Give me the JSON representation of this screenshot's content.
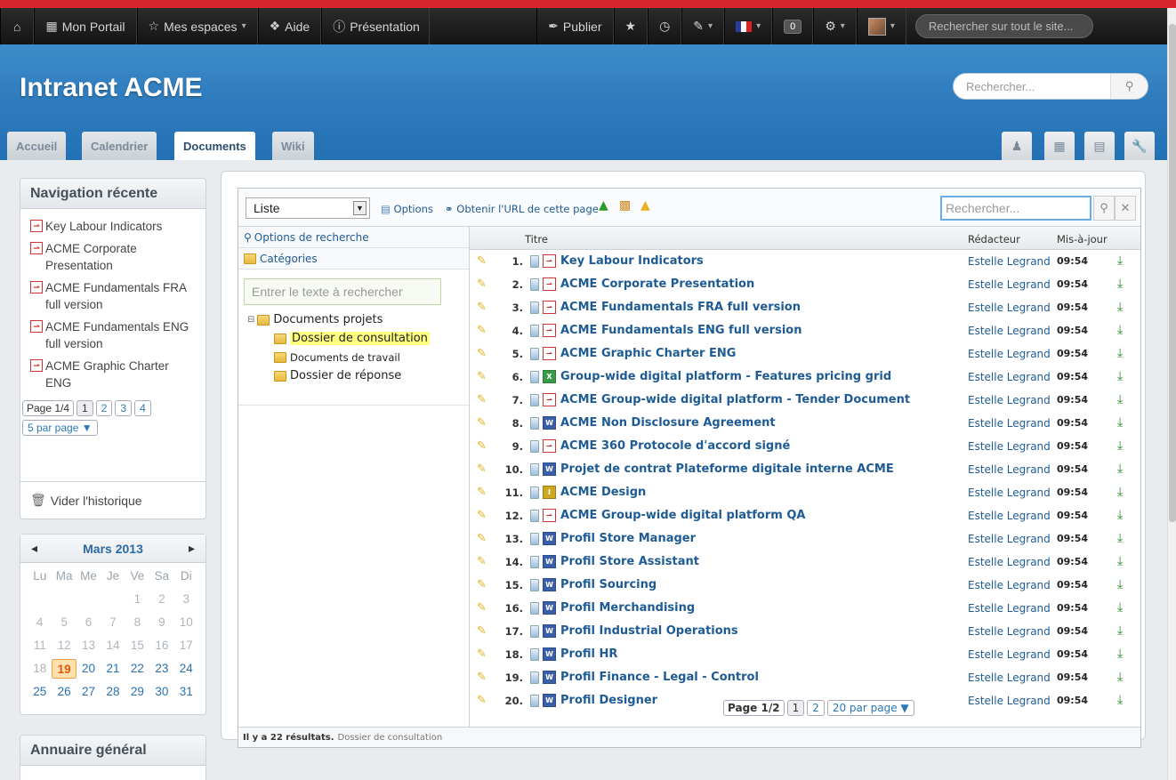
{
  "topbar": {
    "home_icon": "home-icon",
    "portal": "Mon Portail",
    "spaces": "Mes espaces",
    "help": "Aide",
    "presentation": "Présentation",
    "publish": "Publier",
    "notif_count": "0",
    "search_placeholder": "Rechercher sur tout le site..."
  },
  "banner": {
    "title": "Intranet ACME",
    "search_placeholder": "Rechercher..."
  },
  "tabs": [
    {
      "label": "Accueil"
    },
    {
      "label": "Calendrier"
    },
    {
      "label": "Documents"
    },
    {
      "label": "Wiki"
    }
  ],
  "recent_nav": {
    "title": "Navigation récente",
    "items": [
      "Key Labour Indicators",
      "ACME Corporate Presentation",
      "ACME Fundamentals FRA full version",
      "ACME Fundamentals ENG full version",
      "ACME Graphic Charter ENG"
    ],
    "page_label": "Page 1/4",
    "pages": [
      "1",
      "2",
      "3",
      "4"
    ],
    "per_page": "5 par page ▼",
    "clear_history": "Vider l'historique"
  },
  "calendar": {
    "month": "Mars 2013",
    "prev": "◂",
    "next": "▸",
    "dow": [
      "Lu",
      "Ma",
      "Me",
      "Je",
      "Ve",
      "Sa",
      "Di"
    ],
    "today": "19"
  },
  "directory": {
    "title": "Annuaire général"
  },
  "toolbar": {
    "view": "Liste",
    "options": "Options",
    "url": "Obtenir l'URL de cette page",
    "search_placeholder": "Rechercher..."
  },
  "facets": {
    "search_options": "Options de recherche",
    "categories": "Catégories",
    "filter_placeholder": "Entrer le texte à rechercher",
    "root": "Documents projets",
    "folders": [
      "Dossier de consultation",
      "Documents de travail",
      "Dossier de réponse"
    ]
  },
  "table": {
    "headers": {
      "title": "Titre",
      "author": "Rédacteur",
      "updated": "Mis-à-jour"
    },
    "rows": [
      {
        "num": "1.",
        "type": "pdf",
        "title": "Key Labour Indicators",
        "author": "Estelle Legrand",
        "time": "09:54"
      },
      {
        "num": "2.",
        "type": "pdf",
        "title": "ACME Corporate Presentation",
        "author": "Estelle Legrand",
        "time": "09:54"
      },
      {
        "num": "3.",
        "type": "pdf",
        "title": "ACME Fundamentals FRA full version",
        "author": "Estelle Legrand",
        "time": "09:54"
      },
      {
        "num": "4.",
        "type": "pdf",
        "title": "ACME Fundamentals ENG full version",
        "author": "Estelle Legrand",
        "time": "09:54"
      },
      {
        "num": "5.",
        "type": "pdf",
        "title": "ACME Graphic Charter ENG",
        "author": "Estelle Legrand",
        "time": "09:54"
      },
      {
        "num": "6.",
        "type": "xls",
        "title": "Group-wide digital platform - Features pricing grid",
        "author": "Estelle Legrand",
        "time": "09:54"
      },
      {
        "num": "7.",
        "type": "pdf",
        "title": "ACME Group-wide digital platform - Tender Document",
        "author": "Estelle Legrand",
        "time": "09:54"
      },
      {
        "num": "8.",
        "type": "word",
        "title": "ACME Non Disclosure Agreement",
        "author": "Estelle Legrand",
        "time": "09:54"
      },
      {
        "num": "9.",
        "type": "pdf",
        "title": "ACME 360 Protocole d'accord signé",
        "author": "Estelle Legrand",
        "time": "09:54"
      },
      {
        "num": "10.",
        "type": "word",
        "title": "Projet de contrat Plateforme digitale interne ACME",
        "author": "Estelle Legrand",
        "time": "09:54"
      },
      {
        "num": "11.",
        "type": "img",
        "title": "ACME Design",
        "author": "Estelle Legrand",
        "time": "09:54"
      },
      {
        "num": "12.",
        "type": "pdf",
        "title": "ACME Group-wide digital platform QA",
        "author": "Estelle Legrand",
        "time": "09:54"
      },
      {
        "num": "13.",
        "type": "word",
        "title": "Profil Store Manager",
        "author": "Estelle Legrand",
        "time": "09:54"
      },
      {
        "num": "14.",
        "type": "word",
        "title": "Profil Store Assistant",
        "author": "Estelle Legrand",
        "time": "09:54"
      },
      {
        "num": "15.",
        "type": "word",
        "title": "Profil Sourcing",
        "author": "Estelle Legrand",
        "time": "09:54"
      },
      {
        "num": "16.",
        "type": "word",
        "title": "Profil Merchandising",
        "author": "Estelle Legrand",
        "time": "09:54"
      },
      {
        "num": "17.",
        "type": "word",
        "title": "Profil Industrial Operations",
        "author": "Estelle Legrand",
        "time": "09:54"
      },
      {
        "num": "18.",
        "type": "word",
        "title": "Profil HR",
        "author": "Estelle Legrand",
        "time": "09:54"
      },
      {
        "num": "19.",
        "type": "word",
        "title": "Profil Finance - Legal - Control",
        "author": "Estelle Legrand",
        "time": "09:54"
      },
      {
        "num": "20.",
        "type": "word",
        "title": "Profil Designer",
        "author": "Estelle Legrand",
        "time": "09:54"
      }
    ],
    "page_label": "Page 1/2",
    "pages": [
      "1",
      "2"
    ],
    "per_page": "20 par page ▼"
  },
  "status": {
    "results": "Il y a 22 résultats.",
    "folder": "Dossier de consultation"
  },
  "colors": {
    "brand_red": "#d8262c",
    "banner_blue": "#2e7bbd",
    "link": "#1e5b94"
  }
}
